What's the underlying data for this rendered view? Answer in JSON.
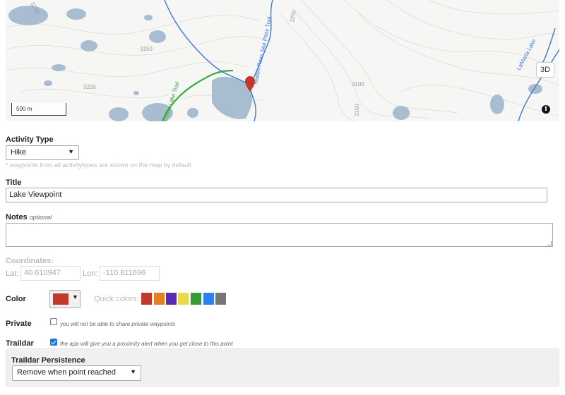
{
  "map": {
    "button_3d": "3D",
    "scale": "500 m",
    "info_icon": "info-icon",
    "contour_labels": [
      "3250",
      "3150",
      "3200",
      "3250",
      "3100",
      "3150"
    ],
    "trail_labels": [
      "Hades-Ross Sea Pass Trail",
      "Dollar Lake Trail",
      "LaMarla Lake"
    ]
  },
  "activity": {
    "label": "Activity Type",
    "value": "Hike",
    "hint": "* waypoints from all activitytypes are shown on the map by default"
  },
  "title": {
    "label": "Title",
    "value": "Lake Viewpoint"
  },
  "notes": {
    "label": "Notes",
    "optional": "optional",
    "value": ""
  },
  "coords": {
    "label": "Coordinates:",
    "lat_label": "Lat:",
    "lat": "40.610947",
    "lon_label": "Lon:",
    "lon": "-110.811696"
  },
  "color": {
    "label": "Color",
    "current": "#c0392b",
    "quick_label": "Quick colors:",
    "quick": [
      "#c0392b",
      "#e67e22",
      "#5b2bb5",
      "#e8d84a",
      "#3a9a3a",
      "#2f7ef2",
      "#777777"
    ]
  },
  "private": {
    "label": "Private",
    "checked": false,
    "text": "you will not be able to share private waypoints"
  },
  "traildar": {
    "label": "Traildar",
    "checked": true,
    "text": "the app will give you a proximity alert when you get close to this point"
  },
  "persistence": {
    "label": "Traildar Persistence",
    "value": "Remove when point reached"
  }
}
